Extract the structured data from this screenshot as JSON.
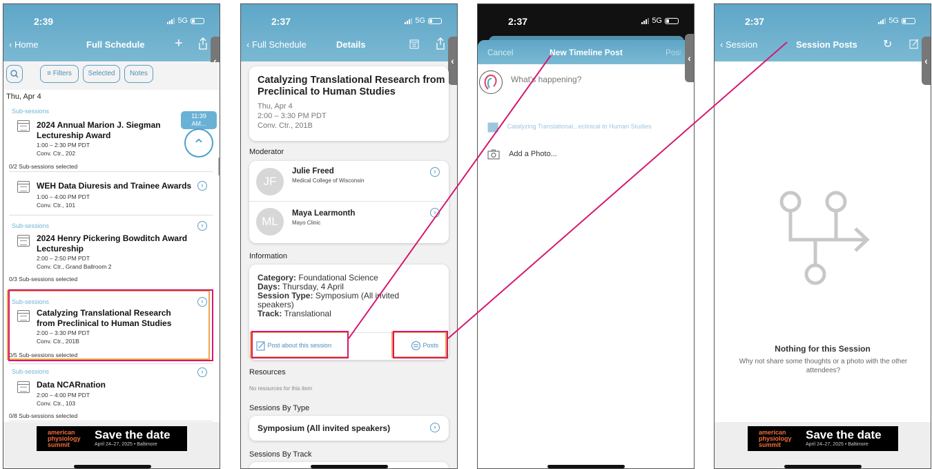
{
  "screens": [
    {
      "time": "2:39",
      "signal": "5G",
      "nav": {
        "back": "Home",
        "title": "Full Schedule",
        "add": "+"
      },
      "filters": [
        "Filters",
        "Selected",
        "Notes"
      ],
      "date_header": "Thu, Apr 4",
      "now_badge": [
        "11:39",
        "AM..."
      ],
      "items": [
        {
          "sub": "Sub-sessions",
          "title": "2024 Annual Marion J. Siegman Lectureship Award",
          "time": "1:00 – 2:30 PM PDT",
          "place": "Conv. Ctr., 202",
          "selected": "0/2 Sub-sessions selected"
        },
        {
          "sub": "",
          "title": "WEH Data Diuresis and Trainee Awards",
          "time": "1:00 – 4:00 PM PDT",
          "place": "Conv. Ctr., 101",
          "selected": ""
        },
        {
          "sub": "Sub-sessions",
          "title": "2024 Henry Pickering Bowditch Award Lectureship",
          "time": "2:00 – 2:50 PM PDT",
          "place": "Conv. Ctr., Grand Ballroom 2",
          "selected": "0/3 Sub-sessions selected"
        },
        {
          "sub": "Sub-sessions",
          "title": "Catalyzing Translational Research from Preclinical to Human Studies",
          "time": "2:00 – 3:30 PM PDT",
          "place": "Conv. Ctr., 201B",
          "selected": "0/5 Sub-sessions selected"
        },
        {
          "sub": "Sub-sessions",
          "title": "Data NCARnation",
          "time": "2:00 – 4:00 PM PDT",
          "place": "Conv. Ctr., 103",
          "selected": "0/8 Sub-sessions selected"
        }
      ],
      "banner": {
        "logo": [
          "american",
          "physiology",
          "summit"
        ],
        "headline": "Save the date",
        "dates": "April 24–27, 2025 • Baltimore"
      }
    },
    {
      "time": "2:37",
      "signal": "5G",
      "nav": {
        "back": "Full Schedule",
        "title": "Details"
      },
      "session": {
        "title": "Catalyzing Translational Research from Preclinical to Human Studies",
        "date": "Thu, Apr 4",
        "time": "2:00 – 3:30 PM PDT",
        "place": "Conv. Ctr., 201B"
      },
      "moderator_label": "Moderator",
      "people": [
        {
          "initials": "JF",
          "name": "Julie Freed",
          "org": "Medical College of Wisconsin"
        },
        {
          "initials": "ML",
          "name": "Maya Learmonth",
          "org": "Mayo Clinic"
        }
      ],
      "info_label": "Information",
      "info": [
        {
          "k": "Category:",
          "v": "Foundational Science"
        },
        {
          "k": "Days:",
          "v": "Thursday, 4 April"
        },
        {
          "k": "Session Type:",
          "v": "Symposium (All invited speakers)"
        },
        {
          "k": "Track:",
          "v": "Translational"
        }
      ],
      "post_btn": "Post about this session",
      "posts_btn": "Posts",
      "resources_label": "Resources",
      "resources_empty": "No resources for this item",
      "by_type_label": "Sessions By Type",
      "by_type_value": "Symposium (All invited speakers)",
      "by_track_label": "Sessions By Track"
    },
    {
      "time": "2:37",
      "signal": "5G",
      "nav": {
        "cancel": "Cancel",
        "title": "New Timeline Post",
        "post": "Post"
      },
      "placeholder": "What's happening?",
      "linked_session": "Catalyzing Translational...eclinical to Human Studies",
      "add_photo": "Add a Photo..."
    },
    {
      "time": "2:37",
      "signal": "5G",
      "nav": {
        "back": "Session",
        "title": "Session Posts"
      },
      "empty_title": "Nothing for this Session",
      "empty_body": "Why not share some thoughts or a photo with the other attendees?",
      "banner": {
        "logo": [
          "american",
          "physiology",
          "summit"
        ],
        "headline": "Save the date",
        "dates": "April 24–27, 2025 • Baltimore"
      }
    }
  ],
  "colors": {
    "header": "#6aafcd",
    "accent": "#5a9ec3",
    "highlight_orange": "#f0a64a",
    "highlight_magenta": "#d6176e"
  }
}
